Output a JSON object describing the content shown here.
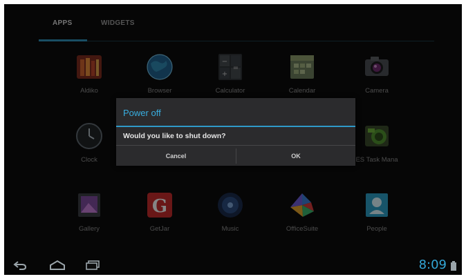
{
  "tabs": {
    "apps": "APPS",
    "widgets": "WIDGETS"
  },
  "apps": {
    "aldiko": "Aldiko",
    "browser": "Browser",
    "calculator": "Calculator",
    "calendar": "Calendar",
    "camera": "Camera",
    "clock": "Clock",
    "task_manager": "ES Task Mana",
    "gallery": "Gallery",
    "getjar": "GetJar",
    "music": "Music",
    "officesuite": "OfficeSuite",
    "people": "People"
  },
  "dialog": {
    "title": "Power off",
    "message": "Would you like to shut down?",
    "cancel_label": "Cancel",
    "ok_label": "OK"
  },
  "status": {
    "time": "8:09"
  },
  "colors": {
    "accent": "#33a6d6",
    "background": "#0b0b0c",
    "dialog": "#2b2b2d"
  },
  "icons": {
    "nav_back": "back-icon",
    "nav_home": "home-icon",
    "nav_recents": "recents-icon",
    "battery": "battery-icon"
  }
}
